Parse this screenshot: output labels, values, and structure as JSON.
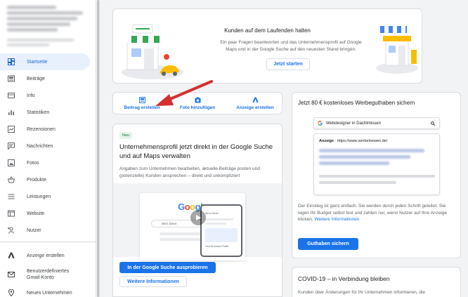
{
  "sidebar": {
    "items": [
      {
        "label": "Startseite",
        "icon": "dashboard-icon"
      },
      {
        "label": "Beiträge",
        "icon": "posts-icon"
      },
      {
        "label": "Info",
        "icon": "info-icon"
      },
      {
        "label": "Statistiken",
        "icon": "bar-chart-icon"
      },
      {
        "label": "Rezensionen",
        "icon": "reviews-icon"
      },
      {
        "label": "Nachrichten",
        "icon": "message-icon"
      },
      {
        "label": "Fotos",
        "icon": "photo-icon"
      },
      {
        "label": "Produkte",
        "icon": "basket-icon"
      },
      {
        "label": "Leistungen",
        "icon": "list-icon"
      },
      {
        "label": "Website",
        "icon": "website-icon"
      },
      {
        "label": "Nutzer",
        "icon": "add-person-icon"
      }
    ],
    "bottom_items": [
      {
        "label": "Anzeige erstellen",
        "icon": "google-ads-icon"
      },
      {
        "label": "Benutzerdefiniertes Gmail-Konto",
        "icon": "mail-icon"
      },
      {
        "label": "Neues Unternehmen",
        "icon": "location-pin-icon"
      }
    ]
  },
  "top_card": {
    "title": "Kunden auf dem Laufenden halten",
    "description": "Ein paar Fragen beantworten und das Unternehmensprofil auf Google Maps und in der Google Suche auf den neuesten Stand bringen.",
    "button": "Jetzt starten"
  },
  "actions": {
    "post": "Beitrag erstellen",
    "photo": "Foto hinzufügen",
    "ad": "Anzeige erstellen"
  },
  "profile_card": {
    "badge": "Neu",
    "title": "Unternehmensprofil jetzt direkt in der Google Suche und auf Maps verwalten",
    "description": "Angaben zum Unternehmen bearbeiten, aktuelle Beiträge posten und (potenzielle) Kunden ansprechen – direkt und unkompliziert",
    "illustration": {
      "logo": "Google",
      "search_text": "Mo's Diner",
      "panel_title": "Mo's Diner",
      "panel_label": "Your Business Profile"
    },
    "button_primary": "In der Google Suche ausprobieren",
    "button_secondary": "Weitere Informationen"
  },
  "ads_card": {
    "title": "Jetzt 80 € kostenloses Werbeguthaben sichern",
    "search_query": "Webdesigner in Dachtmissen",
    "ad_label": "Anzeige",
    "ad_url": "https://www.werbeloewen.de/",
    "description": "Der Einstieg ist ganz einfach. Sie werden durch jeden Schritt geleitet. Sie legen Ihr Budget selbst fest und zahlen nur, wenn Nutzer auf Ihre Anzeige klicken.",
    "link": "Weitere Informationen",
    "button": "Guthaben sichern"
  },
  "covid_card": {
    "title": "COVID-19 – in Verbindung bleiben",
    "description": "Kunden über Änderungen für Ihr Unternehmen informieren, die"
  },
  "colors": {
    "accent": "#1a73e8",
    "annotation_arrow": "#d32f2f",
    "active_bg": "#e8f0fe"
  }
}
